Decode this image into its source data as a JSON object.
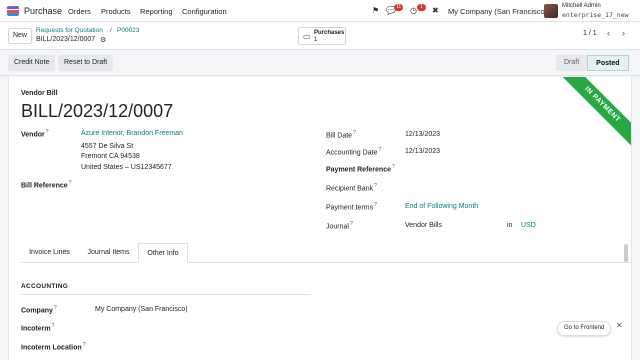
{
  "topbar": {
    "app_name": "Purchase",
    "menus": [
      "Orders",
      "Products",
      "Reporting",
      "Configuration"
    ],
    "chat_badge": "11",
    "activity_badge": "1",
    "company": "My Company (San Francisco)",
    "user_name": "Mitchell Admin",
    "user_db": "enterprise_17_new"
  },
  "control": {
    "new_label": "New",
    "breadcrumb_root": "Requests for Quotation",
    "breadcrumb_sep": "/",
    "breadcrumb_po": "P00023",
    "breadcrumb_current": "BILL/2023/12/0007",
    "smart_label": "Purchases",
    "smart_count": "1",
    "pager": "1 / 1"
  },
  "actions": {
    "credit_note": "Credit Note",
    "reset_draft": "Reset to Draft",
    "status_draft": "Draft",
    "status_posted": "Posted"
  },
  "form": {
    "ribbon": "IN PAYMENT",
    "doc_type": "Vendor Bill",
    "doc_name": "BILL/2023/12/0007",
    "vendor_label": "Vendor",
    "vendor_name": "Azure Interior, Brandon Freeman",
    "vendor_street": "4557 De Silva St",
    "vendor_city": "Fremont CA 94538",
    "vendor_country": "United States – US12345677",
    "bill_ref_label": "Bill Reference",
    "bill_date_label": "Bill Date",
    "bill_date": "12/13/2023",
    "acc_date_label": "Accounting Date",
    "acc_date": "12/13/2023",
    "pay_ref_label": "Payment Reference",
    "recipient_bank_label": "Recipient Bank",
    "pay_terms_label": "Payment terms",
    "pay_terms": "End of Following Month",
    "journal_label": "Journal",
    "journal": "Vendor Bills",
    "journal_in": "in",
    "currency": "USD"
  },
  "tabs": [
    "Invoice Lines",
    "Journal Items",
    "Other Info"
  ],
  "other_info": {
    "section": "ACCOUNTING",
    "company_label": "Company",
    "company_value": "My Company (San Francisco)",
    "incoterm_label": "Incoterm",
    "incoterm_location_label": "Incoterm Location"
  },
  "footer": {
    "goto_frontend": "Go to Frontend"
  },
  "colors": {
    "accent": "#017e84",
    "ribbon": "#28a745",
    "badge": "#e0322e"
  }
}
